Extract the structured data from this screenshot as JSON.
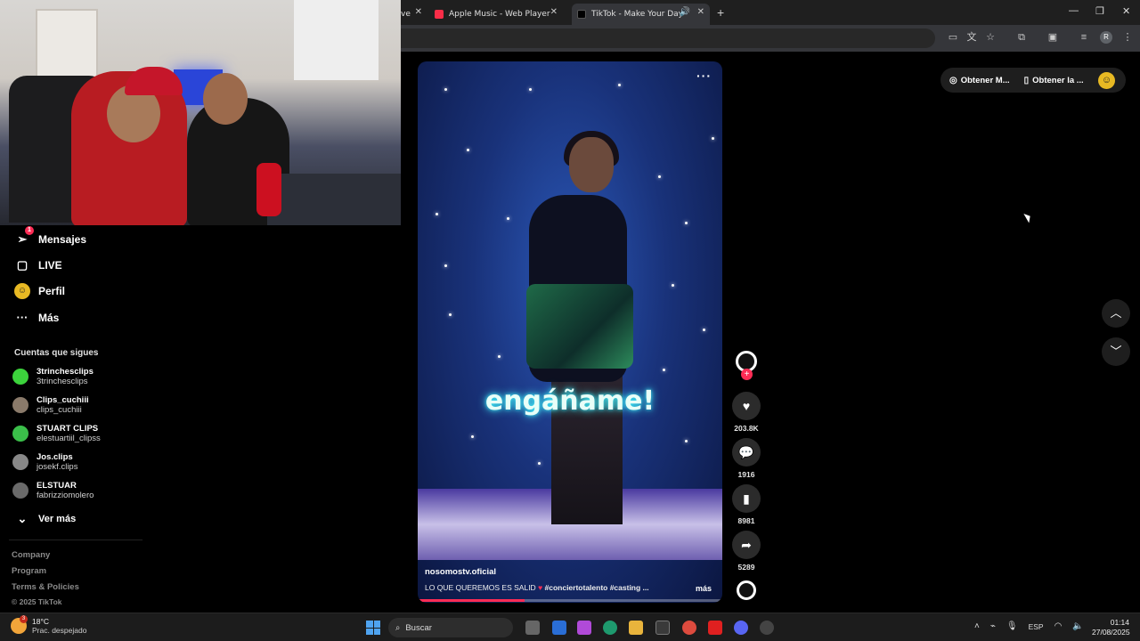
{
  "browser": {
    "tabs": [
      {
        "title": "ve",
        "active": false
      },
      {
        "title": "Apple Music - Web Player",
        "active": false
      },
      {
        "title": "TikTok - Make Your Day",
        "active": true
      }
    ],
    "profile_initial": "R"
  },
  "sidebar": {
    "nav": [
      {
        "label": "Mensajes",
        "badge": "1"
      },
      {
        "label": "LIVE"
      },
      {
        "label": "Perfil"
      },
      {
        "label": "Más"
      }
    ],
    "following_heading": "Cuentas que sigues",
    "accounts": [
      {
        "name": "3trinchesclips",
        "user": "3trinchesclips",
        "color": "#3cd33c"
      },
      {
        "name": "Clips_cuchiii",
        "user": "clips_cuchiii",
        "color": "#8a7a6a"
      },
      {
        "name": "STUART CLIPS",
        "user": "elestuartiil_clipss",
        "color": "#3bbf4a"
      },
      {
        "name": "Jos.clips",
        "user": "josekf.clips",
        "color": "#888888"
      },
      {
        "name": "ELSTUAR",
        "user": "fabrizziomolero",
        "color": "#6a6a6a"
      }
    ],
    "see_more": "Ver más",
    "footer": [
      "Company",
      "Program",
      "Terms & Policies"
    ],
    "copyright": "© 2025 TikTok"
  },
  "video": {
    "caption": "engáñame!",
    "author": "nosomostv.oficial",
    "description": "LO QUE QUEREMOS ES SALID",
    "hashtags": "#conciertotalento #casting ...",
    "more_label": "más",
    "progress": 0.35
  },
  "actions": {
    "likes": "203.8K",
    "comments": "1916",
    "saves": "8981",
    "shares": "5289"
  },
  "top_right": {
    "get_coins": "Obtener M...",
    "get_app": "Obtener la ..."
  },
  "taskbar": {
    "temperature": "18°C",
    "weather": "Prac. despejado",
    "weather_badge": "3",
    "search_placeholder": "Buscar",
    "language": "ESP",
    "time": "01:14",
    "date": "27/08/2025"
  },
  "colors": {
    "accent": "#fe2c55",
    "caption_glow": "#49f3ff"
  }
}
